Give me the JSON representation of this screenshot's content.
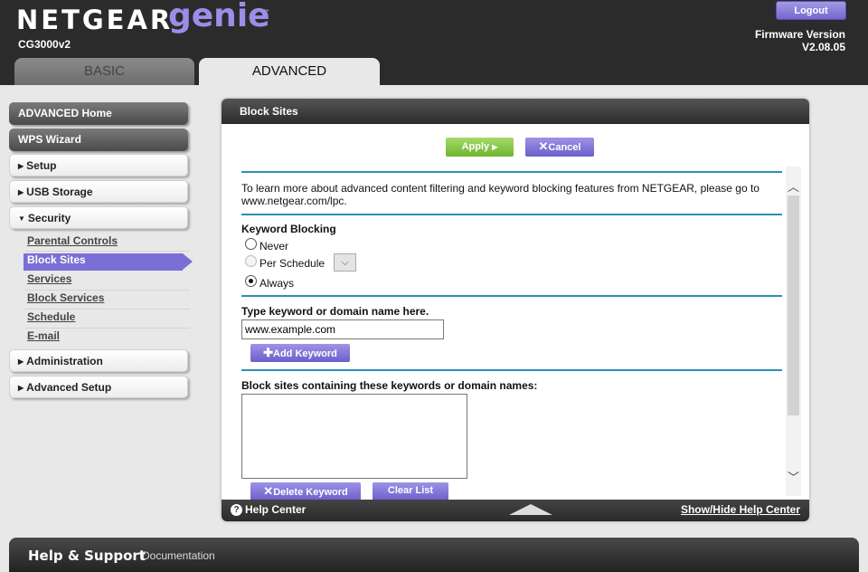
{
  "header": {
    "logo_netgear": "NETGEAR",
    "logo_genie": "genie",
    "logo_tm": "™",
    "model": "CG3000v2",
    "logout_label": "Logout",
    "firmware_label": "Firmware Version",
    "firmware_version": "V2.08.05",
    "tabs": [
      {
        "label": "BASIC"
      },
      {
        "label": "ADVANCED"
      }
    ]
  },
  "sidebar": {
    "advanced_home": "ADVANCED Home",
    "wps_wizard": "WPS Wizard",
    "setup": "Setup",
    "usb_storage": "USB Storage",
    "security": "Security",
    "security_items": [
      "Parental Controls",
      "Block Sites",
      "Services",
      "Block Services",
      "Schedule",
      "E-mail"
    ],
    "administration": "Administration",
    "advanced_setup": "Advanced Setup"
  },
  "panel": {
    "title": "Block Sites",
    "apply_label": "Apply",
    "cancel_label": "Cancel",
    "info_text_1": "To learn more about advanced content filtering and keyword blocking features from NETGEAR, please go to",
    "info_text_2": "www.netgear.com/lpc.",
    "keyword_blocking_heading": "Keyword Blocking",
    "radio_never": "Never",
    "radio_per_schedule": "Per Schedule",
    "radio_always": "Always",
    "keyword_prompt": "Type keyword or domain name here.",
    "keyword_input_value": "www.example.com",
    "add_keyword_label": "Add Keyword",
    "list_heading": "Block sites containing these keywords or domain names:",
    "delete_keyword_label": "Delete Keyword",
    "clear_list_label": "Clear List",
    "help_center": "Help Center",
    "show_hide_help": "Show/Hide Help Center",
    "selected_mode": "Always"
  },
  "footer": {
    "help_support": "Help & Support",
    "documentation": "Documentation"
  }
}
